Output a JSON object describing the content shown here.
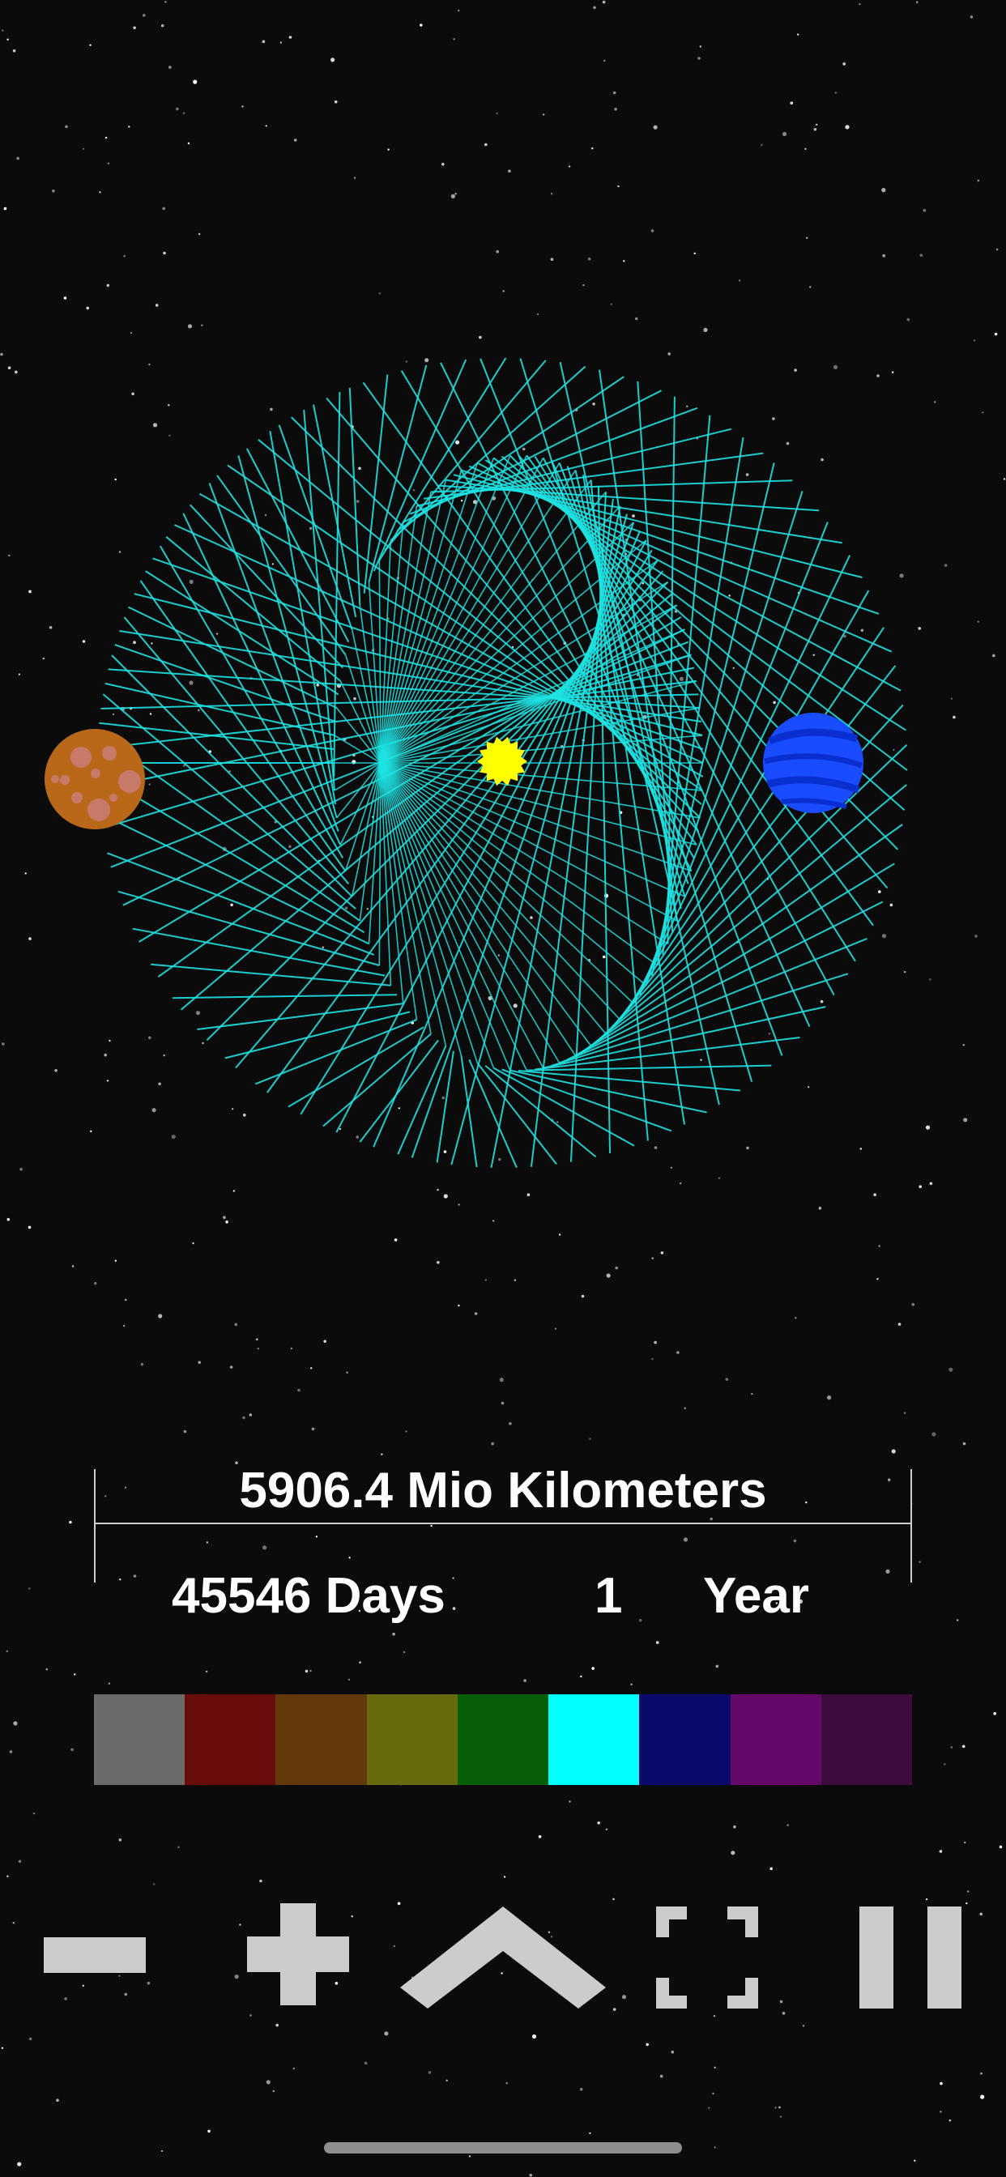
{
  "readout": {
    "distance": "5906.4 Mio Kilometers",
    "days": "45546 Days",
    "year_value": "1",
    "year_label": "Year"
  },
  "palette": [
    {
      "name": "gray",
      "color": "#6b6b6b"
    },
    {
      "name": "dark-red",
      "color": "#6b0c0c"
    },
    {
      "name": "brown",
      "color": "#63380b"
    },
    {
      "name": "olive",
      "color": "#686a0c"
    },
    {
      "name": "green",
      "color": "#085e08"
    },
    {
      "name": "cyan",
      "color": "#00ffff"
    },
    {
      "name": "navy",
      "color": "#0a0a6a"
    },
    {
      "name": "purple",
      "color": "#64086a"
    },
    {
      "name": "dark-purple",
      "color": "#3d0c3d"
    }
  ],
  "colors": {
    "orbit_lines": "#1fe3e3",
    "sun": "#ffff00",
    "planet_outer": "#b9681a",
    "planet_blue": "#1a4cff"
  },
  "controls": [
    "minus-icon",
    "plus-icon",
    "chevron-up-icon",
    "fullscreen-icon",
    "pause-icon"
  ]
}
